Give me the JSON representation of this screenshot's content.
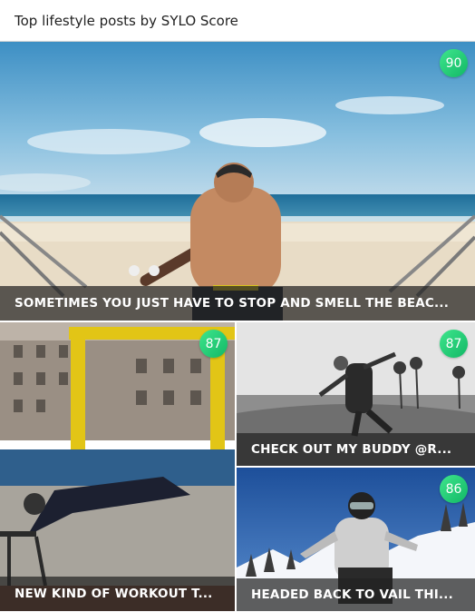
{
  "header": {
    "title": "Top lifestyle posts by SYLO Score"
  },
  "posts": [
    {
      "caption": "SOMETIMES YOU JUST HAVE TO STOP AND SMELL THE BEAC...",
      "score": "90"
    },
    {
      "caption": "NEW KIND OF WORKOUT T...",
      "score": "87"
    },
    {
      "caption": "CHECK OUT MY BUDDY @R...",
      "score": "87"
    },
    {
      "caption": "HEADED BACK TO VAIL THI...",
      "score": "86"
    }
  ],
  "colors": {
    "score_badge": "#2bd07a",
    "caption_bg": "#3a3a3a"
  }
}
